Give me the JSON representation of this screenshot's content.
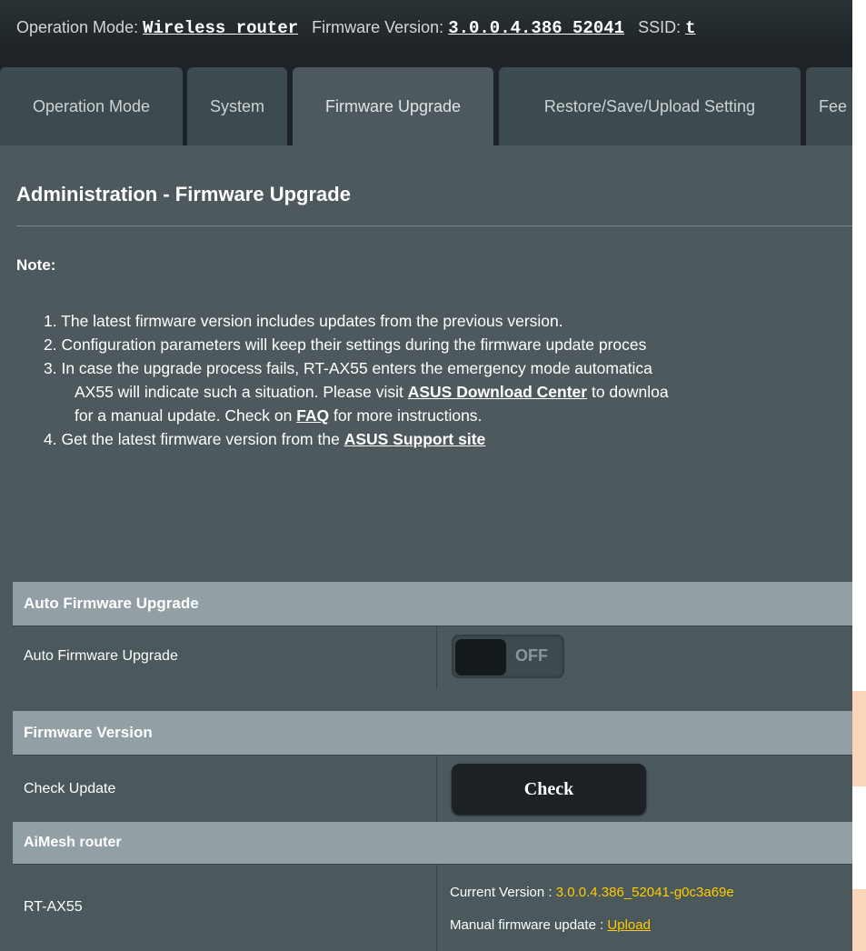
{
  "status_bar": {
    "op_mode_label": "Operation Mode:",
    "op_mode_value": "Wireless router",
    "firmware_label": "Firmware Version:",
    "firmware_value": "3.0.0.4.386_52041",
    "ssid_label": "SSID:",
    "ssid_value": "t"
  },
  "tabs": [
    {
      "label": "Operation Mode"
    },
    {
      "label": "System"
    },
    {
      "label": "Firmware Upgrade"
    },
    {
      "label": "Restore/Save/Upload Setting"
    },
    {
      "label": "Fee"
    }
  ],
  "page": {
    "title": "Administration - Firmware Upgrade",
    "note_label": "Note:",
    "notes": {
      "n1": "1. The latest firmware version includes updates from the previous version.",
      "n2": "2. Configuration parameters will keep their settings during the firmware update proces",
      "n3a": "3. In case the upgrade process fails, RT-AX55 enters the emergency mode automatica",
      "n3b_pre": "AX55 will indicate such a situation. Please visit ",
      "n3b_link": "ASUS Download Center",
      "n3b_post": " to downloa",
      "n3c_pre": "for a manual update. Check on ",
      "n3c_link": "FAQ",
      "n3c_post": " for more instructions.",
      "n4_pre": "4. Get the latest firmware version from the ",
      "n4_link": "ASUS Support site"
    }
  },
  "auto_upgrade": {
    "section_title": "Auto Firmware Upgrade",
    "row_label": "Auto Firmware Upgrade",
    "toggle_state": "OFF"
  },
  "firmware_version": {
    "section_title": "Firmware Version",
    "row_label": "Check Update",
    "button_label": "Check"
  },
  "aimesh": {
    "section_title": "AiMesh router",
    "device_name": "RT-AX55",
    "current_version_label": "Current Version : ",
    "current_version_value": "3.0.0.4.386_52041-g0c3a69e",
    "manual_update_label": "Manual firmware update : ",
    "upload_link": "Upload"
  },
  "colors": {
    "background": "#4d595d",
    "section_header": "#92a0a5",
    "highlight_yellow": "#ffcc00"
  }
}
